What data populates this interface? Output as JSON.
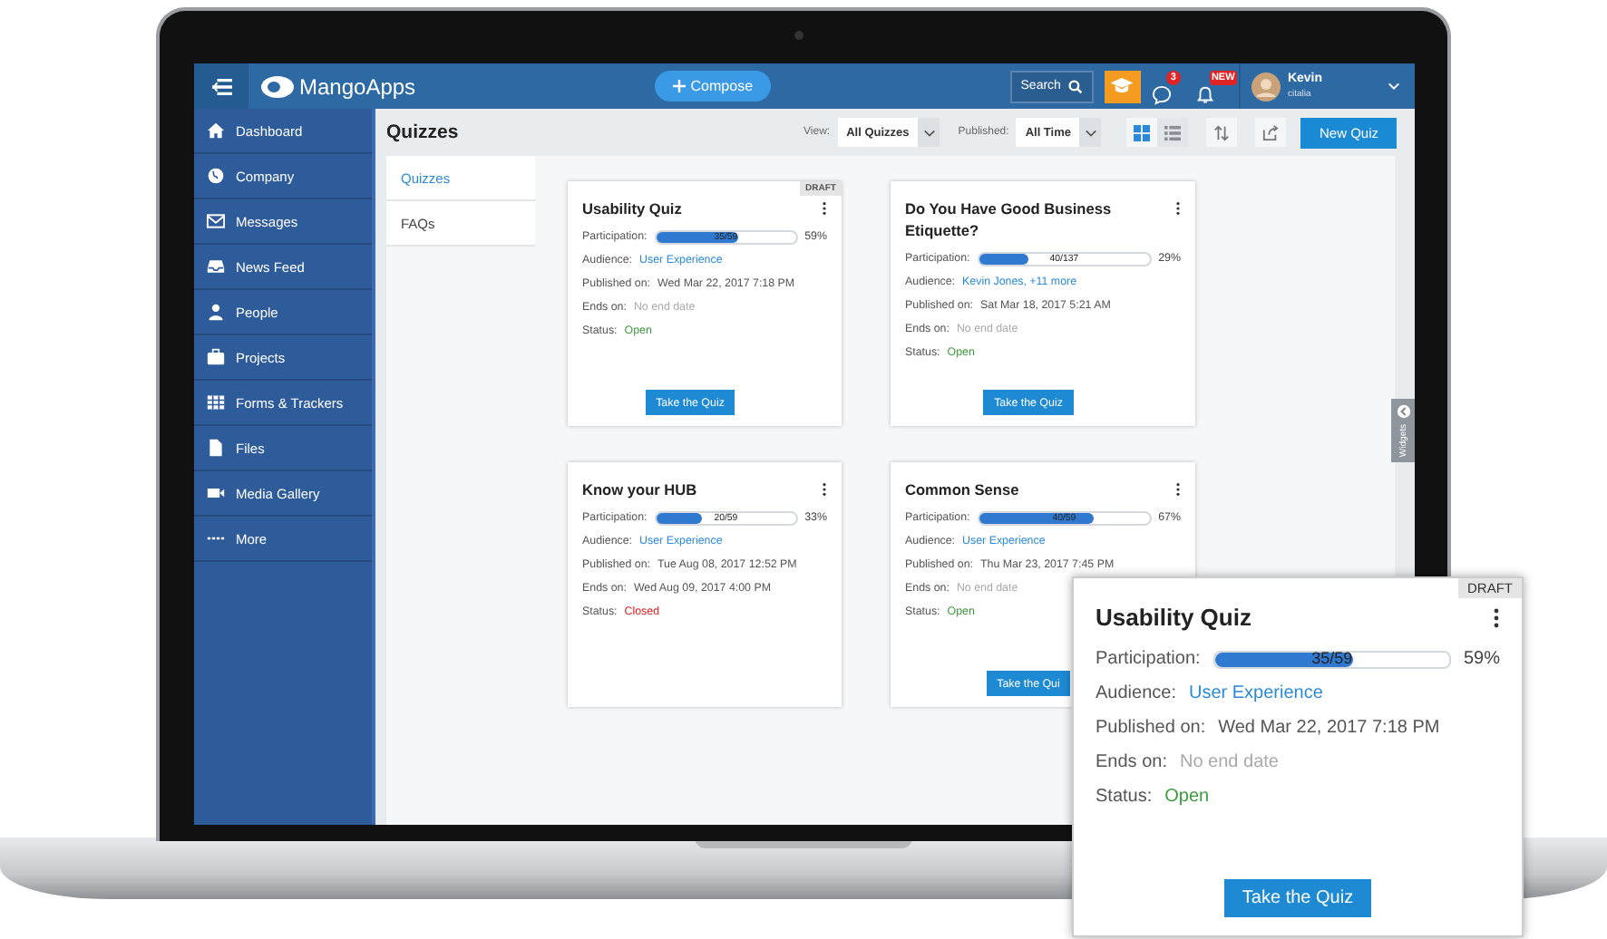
{
  "topbar": {
    "logo": "MangoApps",
    "compose": "Compose",
    "search": "Search",
    "chat_badge": "3",
    "alert_badge": "NEW",
    "user_name": "Kevin",
    "user_sub": "citalia"
  },
  "sidebar": {
    "items": [
      {
        "label": "Dashboard",
        "selected": false
      },
      {
        "label": "Company",
        "selected": false
      },
      {
        "label": "Messages",
        "selected": false
      },
      {
        "label": "News Feed",
        "selected": false
      },
      {
        "label": "People",
        "selected": false
      },
      {
        "label": "Projects",
        "selected": false
      },
      {
        "label": "Forms & Trackers",
        "selected": false
      },
      {
        "label": "Files",
        "selected": false
      },
      {
        "label": "Media Gallery",
        "selected": false
      },
      {
        "label": "More",
        "selected": false
      }
    ]
  },
  "header": {
    "title": "Quizzes",
    "view_label": "View:",
    "view_value": "All Quizzes",
    "published_label": "Published:",
    "published_value": "All Time",
    "layouts": [
      {
        "kind": "grid",
        "selected": true
      },
      {
        "kind": "list",
        "selected": false
      }
    ],
    "new_button": "New Quiz"
  },
  "subnav": [
    {
      "label": "Quizzes",
      "selected": true
    },
    {
      "label": "FAQs",
      "selected": false
    }
  ],
  "cards": [
    {
      "title": "Usability Quiz",
      "draft": "DRAFT",
      "participation_label": "Participation:",
      "level": 0.59,
      "reading": "35/59",
      "percent": "59%",
      "audience_label": "Audience:",
      "audience": "User Experience",
      "published_label": "Published on:",
      "published": "Wed Mar 22, 2017 7:18 PM",
      "ends_label": "Ends on:",
      "ends": "No end date",
      "no_end_date": true,
      "status_label": "Status:",
      "status": "Open",
      "closed": false,
      "button": "Take the Quiz"
    },
    {
      "title": "Do You Have Good Business Etiquette?",
      "participation_label": "Participation:",
      "level": 0.29,
      "reading": "40/137",
      "percent": "29%",
      "audience_label": "Audience:",
      "audience": "Kevin Jones, +11 more",
      "published_label": "Published on:",
      "published": "Sat Mar 18, 2017 5:21 AM",
      "ends_label": "Ends on:",
      "ends": "No end date",
      "no_end_date": true,
      "status_label": "Status:",
      "status": "Open",
      "closed": false,
      "button": "Take the Quiz"
    },
    {
      "title": "Know your HUB",
      "participation_label": "Participation:",
      "level": 0.33,
      "reading": "20/59",
      "percent": "33%",
      "audience_label": "Audience:",
      "audience": "User Experience",
      "published_label": "Published on:",
      "published": "Tue Aug 08, 2017 12:52 PM",
      "ends_label": "Ends on:",
      "ends": "Wed Aug 09, 2017 4:00 PM",
      "no_end_date": false,
      "status_label": "Status:",
      "status": "Closed",
      "closed": true
    },
    {
      "title": "Common Sense",
      "participation_label": "Participation:",
      "level": 0.67,
      "reading": "40/59",
      "percent": "67%",
      "audience_label": "Audience:",
      "audience": "User Experience",
      "published_label": "Published on:",
      "published": "Thu Mar 23, 2017 7:45 PM",
      "ends_label": "Ends on:",
      "ends": "No end date",
      "no_end_date": true,
      "status_label": "Status:",
      "status": "Open",
      "closed": false,
      "button": "Take the Qui"
    }
  ],
  "widgets_tab": "Widgets",
  "callout": {
    "title": "Usability Quiz",
    "draft": "DRAFT",
    "participation_label": "Participation:",
    "level": 0.59,
    "reading": "35/59",
    "percent": "59%",
    "audience_label": "Audience:",
    "audience": "User Experience",
    "published_label": "Published on:",
    "published": "Wed Mar 22, 2017 7:18 PM",
    "ends_label": "Ends on:",
    "ends": "No end date",
    "no_end_date": true,
    "status_label": "Status:",
    "status": "Open",
    "closed": false,
    "button": "Take the Quiz"
  }
}
